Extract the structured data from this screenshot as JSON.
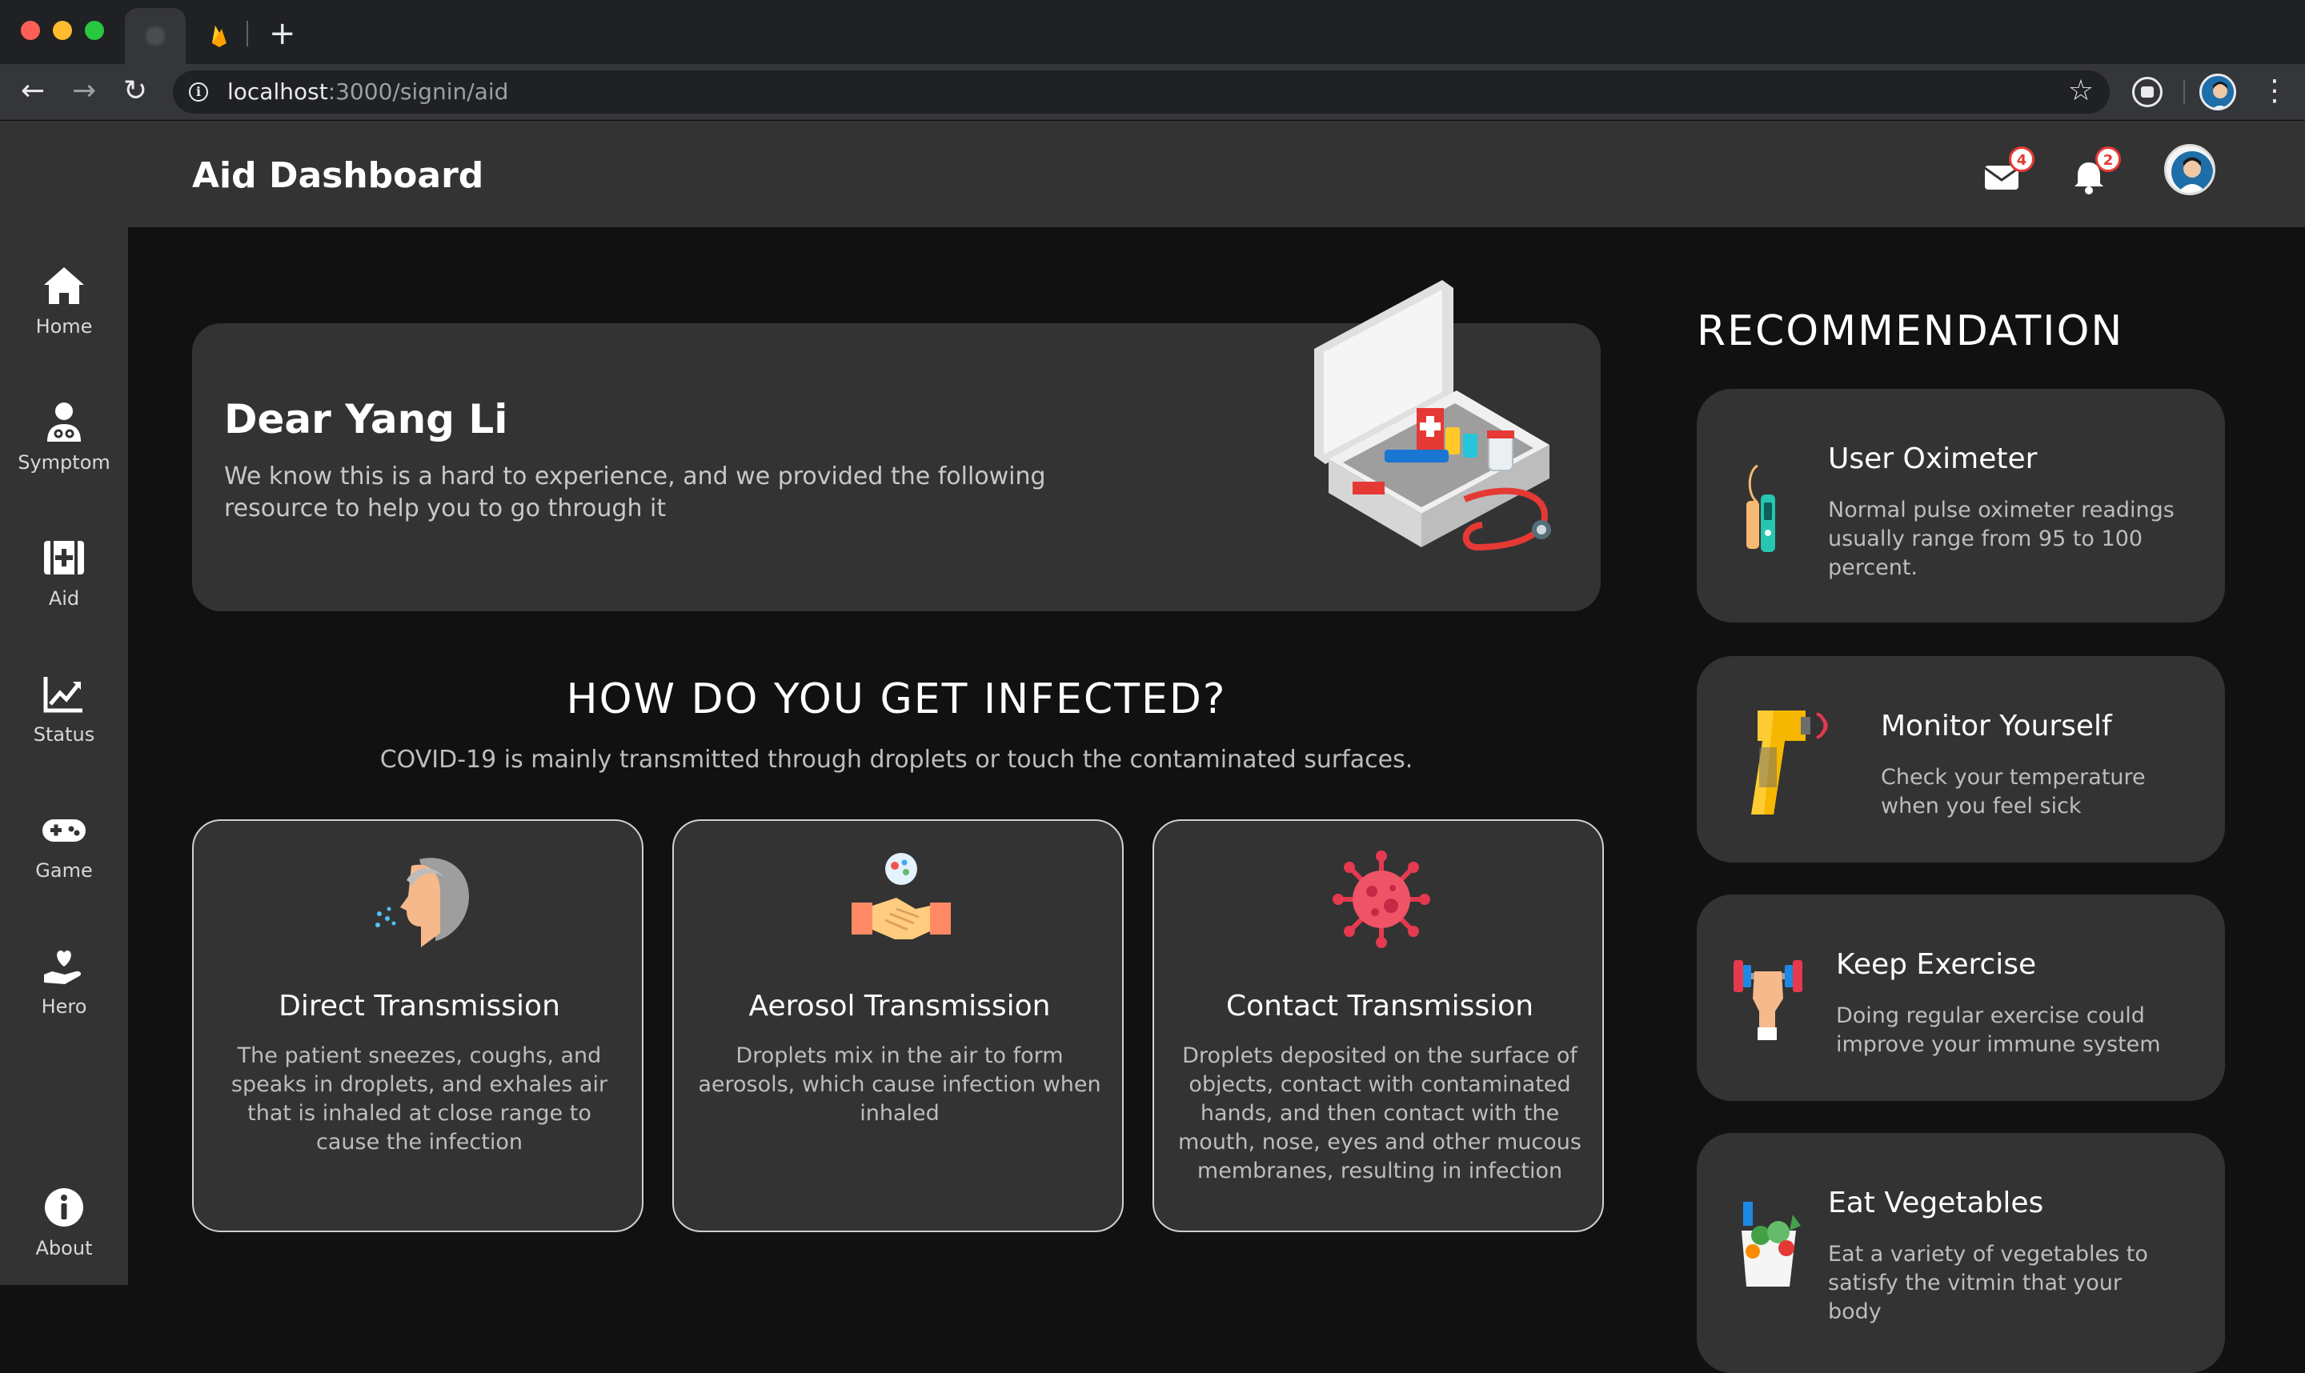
{
  "browser": {
    "url_host": "localhost",
    "url_path": ":3000/signin/aid"
  },
  "header": {
    "title": "Aid Dashboard",
    "mail_count": "4",
    "notification_count": "2"
  },
  "sidebar": {
    "items": [
      {
        "label": "Home",
        "icon": "home-icon"
      },
      {
        "label": "Symptom",
        "icon": "doctor-icon"
      },
      {
        "label": "Aid",
        "icon": "first-aid-icon"
      },
      {
        "label": "Status",
        "icon": "chart-icon"
      },
      {
        "label": "Game",
        "icon": "gamepad-icon"
      },
      {
        "label": "Hero",
        "icon": "heart-hand-icon"
      },
      {
        "label": "About",
        "icon": "info-icon"
      }
    ]
  },
  "welcome": {
    "title": "Dear Yang Li",
    "text": "We know this is a hard to experience, and we provided the following resource to help you to go through it"
  },
  "infection": {
    "title": "HOW DO YOU GET INFECTED?",
    "subtitle": "COVID-19 is mainly transmitted through droplets or touch the contaminated surfaces.",
    "cards": [
      {
        "title": "Direct Transmission",
        "text": "The patient sneezes, coughs, and speaks in droplets, and exhales air that is inhaled at close range to cause the infection",
        "icon": "sneeze-icon"
      },
      {
        "title": "Aerosol Transmission",
        "text": "Droplets mix in the air to form aerosols, which cause infection when inhaled",
        "icon": "handshake-icon"
      },
      {
        "title": "Contact Transmission",
        "text": "Droplets deposited on the surface of objects, contact with contaminated hands, and then contact with the mouth, nose, eyes and other mucous membranes, resulting in infection",
        "icon": "virus-icon"
      }
    ]
  },
  "recommendation": {
    "title": "RECOMMENDATION",
    "items": [
      {
        "title": "User Oximeter",
        "text": "Normal pulse oximeter readings usually range from 95 to 100 percent.",
        "icon": "oximeter-icon"
      },
      {
        "title": "Monitor Yourself",
        "text": "Check your temperature when you feel sick",
        "icon": "thermometer-gun-icon"
      },
      {
        "title": "Keep Exercise",
        "text": "Doing regular exercise could improve your immune system",
        "icon": "dumbbell-icon"
      },
      {
        "title": "Eat Vegetables",
        "text": "Eat a variety of vegetables to satisfy the vitmin that your body",
        "icon": "vegetables-icon"
      }
    ]
  },
  "colors": {
    "app_bg": "#111111",
    "panel": "#333333",
    "badge_red": "#e53935"
  }
}
